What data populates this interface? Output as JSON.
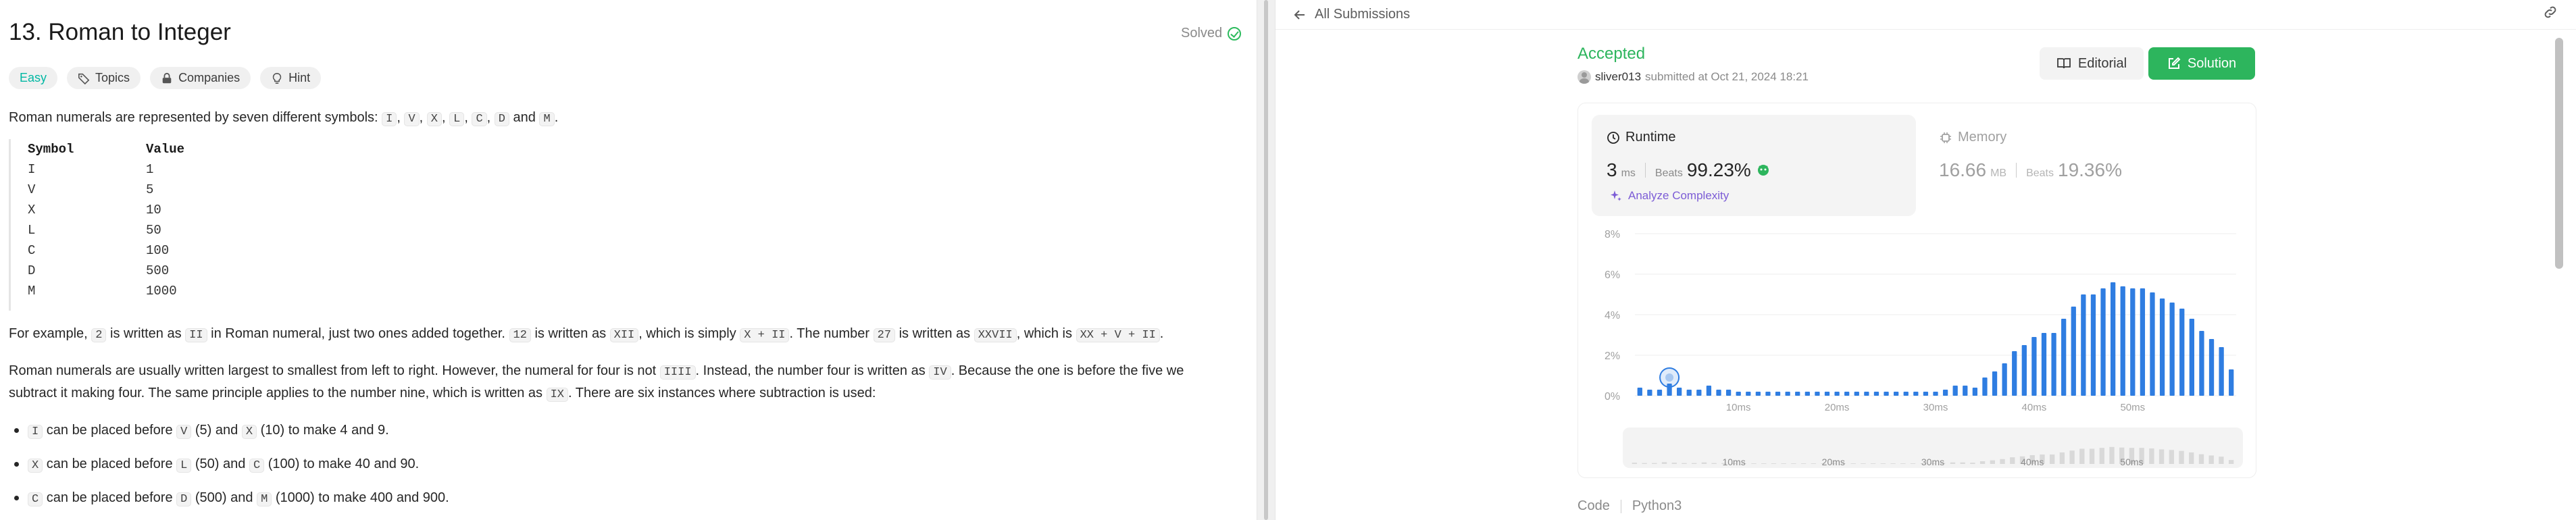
{
  "problem": {
    "title": "13. Roman to Integer",
    "solved_label": "Solved",
    "tags": [
      "Easy",
      "Topics",
      "Companies",
      "Hint"
    ],
    "intro_before": "Roman numerals are represented by seven different symbols: ",
    "symbols": [
      "I",
      "V",
      "X",
      "L",
      "C",
      "D",
      "M"
    ],
    "and_word": "and",
    "table": {
      "headers": [
        "Symbol",
        "Value"
      ],
      "rows": [
        [
          "I",
          "1"
        ],
        [
          "V",
          "5"
        ],
        [
          "X",
          "10"
        ],
        [
          "L",
          "50"
        ],
        [
          "C",
          "100"
        ],
        [
          "D",
          "500"
        ],
        [
          "M",
          "1000"
        ]
      ]
    },
    "example": {
      "t1": "For example, ",
      "c1": "2",
      "t2": " is written as ",
      "c2": "II",
      "t3": " in Roman numeral, just two ones added together. ",
      "c3": "12",
      "t4": " is written as ",
      "c4": "XII",
      "t5": ", which is simply ",
      "c5": "X + II",
      "t6": ". The number ",
      "c6": "27",
      "t7": " is written as ",
      "c7": "XXVII",
      "t8": ", which is ",
      "c8": "XX + V + II",
      "t9": "."
    },
    "para2": {
      "t1": "Roman numerals are usually written largest to smallest from left to right. However, the numeral for four is not ",
      "c1": "IIII",
      "t2": ". Instead, the number four is written as ",
      "c2": "IV",
      "t3": ". Because the one is before the five we",
      "line2_t1": "subtract it making four. The same principle applies to the number nine, which is written as ",
      "line2_c1": "IX",
      "line2_t2": ". There are six instances where subtraction is used:"
    },
    "bullets": [
      {
        "c1": "I",
        "t1": " can be placed before ",
        "c2": "V",
        "t2": " (5) and ",
        "c3": "X",
        "t3": " (10) to make 4 and 9."
      },
      {
        "c1": "X",
        "t1": " can be placed before ",
        "c2": "L",
        "t2": " (50) and ",
        "c3": "C",
        "t3": " (100) to make 40 and 90."
      },
      {
        "c1": "C",
        "t1": " can be placed before ",
        "c2": "D",
        "t2": " (500) and ",
        "c3": "M",
        "t3": " (1000) to make 400 and 900."
      }
    ]
  },
  "submission": {
    "back_label": "All Submissions",
    "status": "Accepted",
    "user": "sliver013",
    "submitted_at": "submitted at Oct 21, 2024 18:21",
    "editorial_label": "Editorial",
    "solution_label": "Solution",
    "runtime": {
      "label": "Runtime",
      "value": "3",
      "unit": "ms",
      "beats_label": "Beats",
      "beats_value": "99.23%"
    },
    "memory": {
      "label": "Memory",
      "value": "16.66",
      "unit": "MB",
      "beats_label": "Beats",
      "beats_value": "19.36%"
    },
    "analyze_label": "Analyze Complexity",
    "code_label": "Code",
    "language": "Python3"
  },
  "colors": {
    "accent_green": "#2db55d",
    "bar_blue": "#2f7de1",
    "easy_teal": "#00b8a3",
    "analyze_purple": "#7c5cd6"
  },
  "chart_data": {
    "type": "bar",
    "title": "",
    "xlabel": "",
    "ylabel": "",
    "y_ticks": [
      "8%",
      "6%",
      "4%",
      "2%",
      "0%"
    ],
    "ylim": [
      0,
      8
    ],
    "x_ticks": [
      {
        "ms": 10,
        "label": "10ms"
      },
      {
        "ms": 20,
        "label": "20ms"
      },
      {
        "ms": 30,
        "label": "30ms"
      },
      {
        "ms": 40,
        "label": "40ms"
      },
      {
        "ms": 50,
        "label": "50ms"
      }
    ],
    "x_ms": [
      0,
      1,
      2,
      3,
      4,
      5,
      6,
      7,
      8,
      9,
      10,
      11,
      12,
      13,
      14,
      15,
      16,
      17,
      18,
      19,
      20,
      21,
      22,
      23,
      24,
      25,
      26,
      27,
      28,
      29,
      30,
      31,
      32,
      33,
      34,
      35,
      36,
      37,
      38,
      39,
      40,
      41,
      42,
      43,
      44,
      45,
      46,
      47,
      48,
      49,
      50,
      51,
      52,
      53,
      54,
      55,
      56,
      57,
      58,
      59
    ],
    "values": [
      0.4,
      0.3,
      0.3,
      0.6,
      0.4,
      0.3,
      0.3,
      0.5,
      0.3,
      0.3,
      0.2,
      0.2,
      0.2,
      0.2,
      0.2,
      0.2,
      0.2,
      0.2,
      0.2,
      0.2,
      0.2,
      0.2,
      0.2,
      0.2,
      0.2,
      0.2,
      0.2,
      0.2,
      0.2,
      0.2,
      0.2,
      0.3,
      0.5,
      0.5,
      0.4,
      0.9,
      1.2,
      1.6,
      2.2,
      2.5,
      2.9,
      3.1,
      3.1,
      3.8,
      4.4,
      5.0,
      5.0,
      5.3,
      5.6,
      5.4,
      5.3,
      5.3,
      5.1,
      4.8,
      4.6,
      4.3,
      3.8,
      3.2,
      2.8,
      2.4
    ],
    "extra_values": [
      1.3
    ],
    "highlight_ms": 3,
    "grid": true
  }
}
